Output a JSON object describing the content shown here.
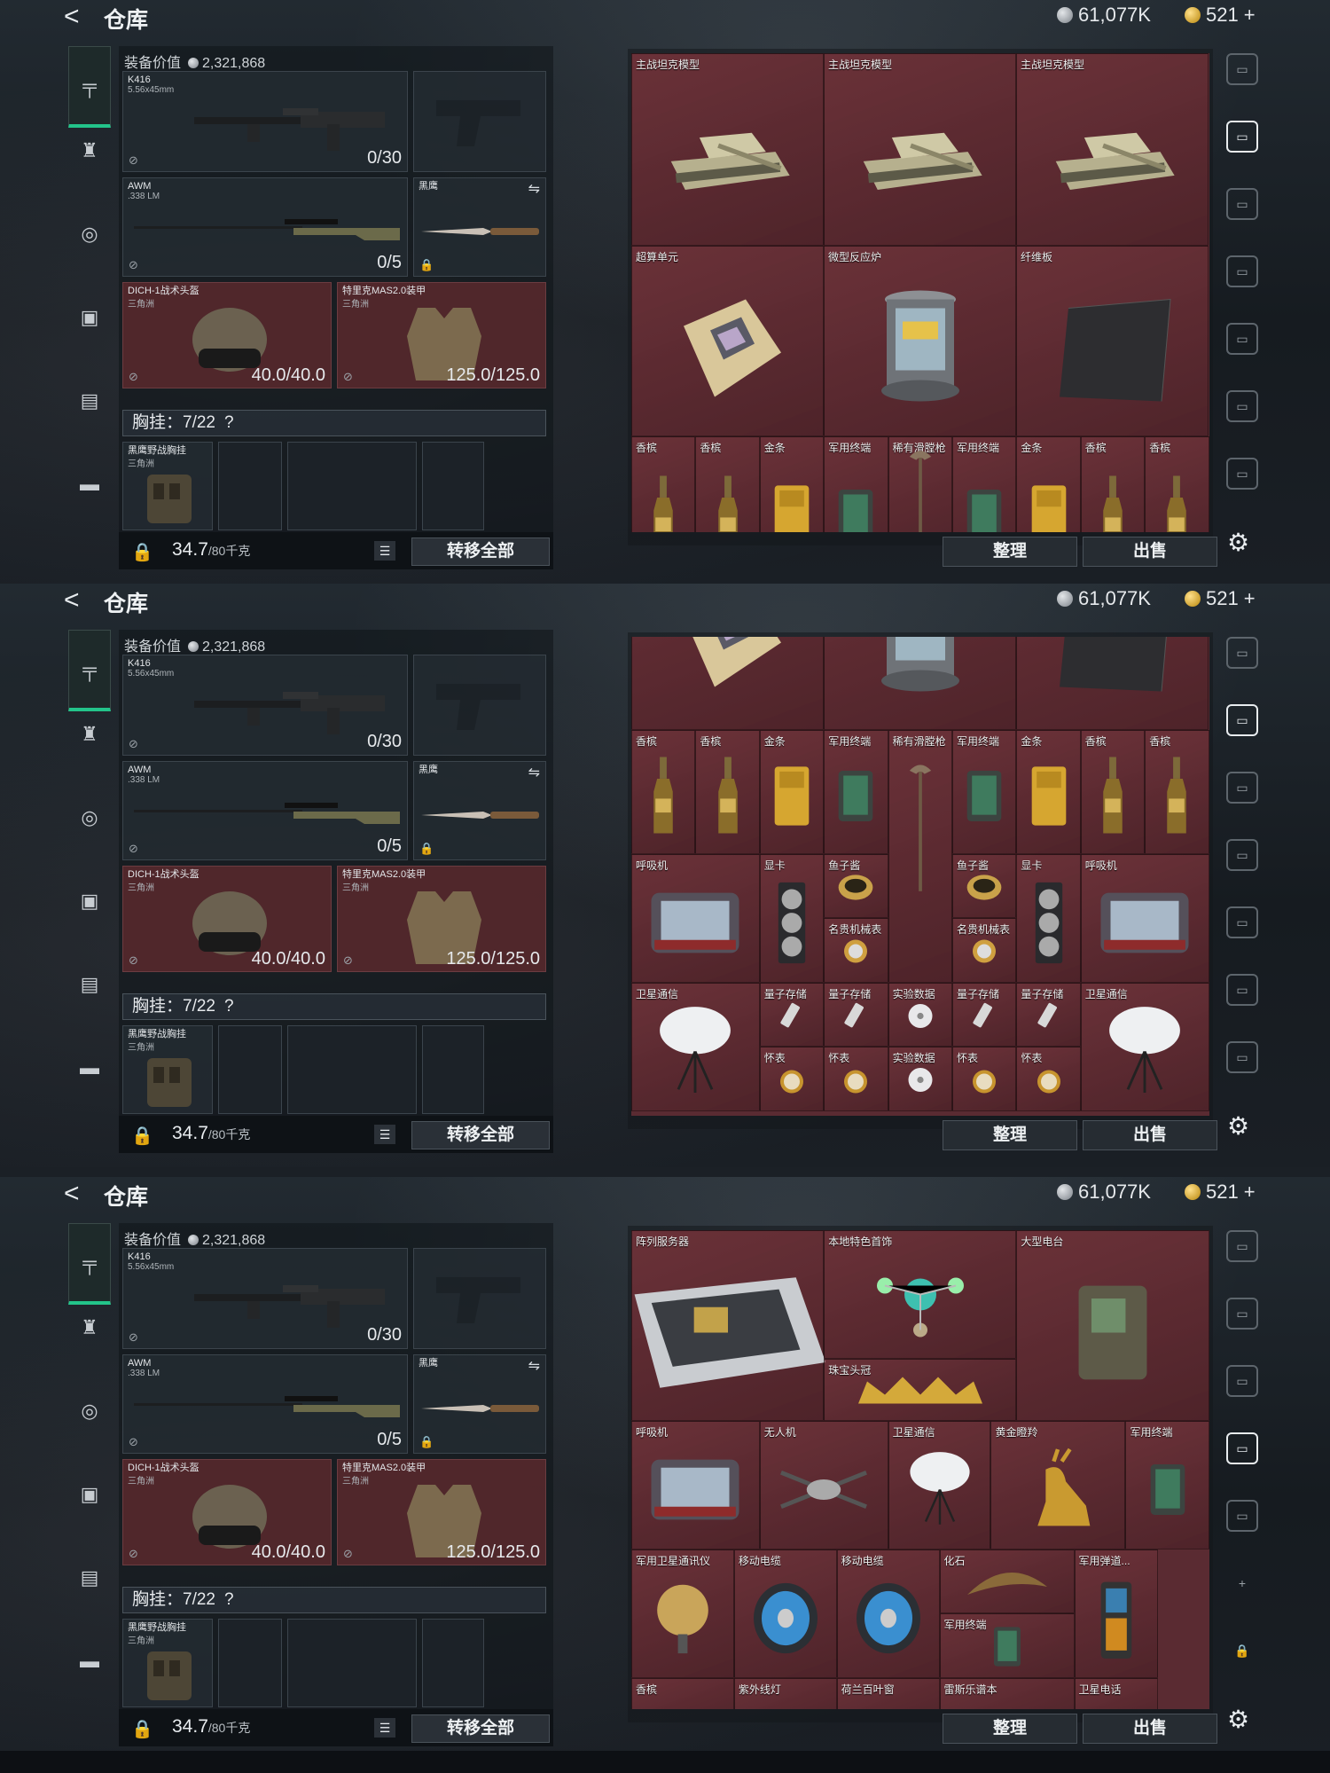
{
  "header": {
    "back_glyph": "<",
    "title": "仓库",
    "silver": "61,077K",
    "gold": "521",
    "gold_plus": "+"
  },
  "equipment": {
    "value_label": "装备价值",
    "value": "2,321,868",
    "primary": {
      "name": "K416",
      "caliber": "5.56x45mm",
      "ammo": "0/30"
    },
    "sniper": {
      "name": "AWM",
      "caliber": ".338 LM",
      "ammo": "0/5"
    },
    "melee": {
      "name": "黑鹰"
    },
    "helmet": {
      "name": "DICH-1战术头盔",
      "origin": "三角洲",
      "durability": "40.0/40.0"
    },
    "armor": {
      "name": "特里克MAS2.0装甲",
      "origin": "三角洲",
      "durability": "125.0/125.0"
    },
    "chest_label": "胸挂：7/22",
    "chest_help": "?",
    "chest_item": {
      "name": "黑鹰野战胸挂",
      "origin": "三角洲"
    },
    "weight": "34.7",
    "weight_cap": "/80千克",
    "transfer_all": "转移全部"
  },
  "storage": {
    "sort_label": "整理",
    "sell_label": "出售"
  },
  "screen1": {
    "items": [
      "主战坦克模型",
      "主战坦克模型",
      "主战坦克模型",
      "超算单元",
      "微型反应炉",
      "纤维板",
      "香槟",
      "香槟",
      "金条",
      "军用终端",
      "稀有滑膛枪",
      "军用终端",
      "金条",
      "香槟",
      "香槟"
    ]
  },
  "screen2": {
    "items": [
      "香槟",
      "香槟",
      "金条",
      "军用终端",
      "稀有滑膛枪",
      "军用终端",
      "金条",
      "香槟",
      "香槟",
      "呼吸机",
      "显卡",
      "鱼子酱",
      "鱼子酱",
      "显卡",
      "呼吸机",
      "名贵机械表",
      "名贵机械表",
      "卫星通信",
      "量子存储",
      "量子存储",
      "实验数据",
      "量子存储",
      "量子存储",
      "卫星通信",
      "怀表",
      "怀表",
      "实验数据",
      "怀表",
      "怀表"
    ]
  },
  "screen3": {
    "items": [
      "阵列服务器",
      "本地特色首饰",
      "大型电台",
      "珠宝头冠",
      "呼吸机",
      "无人机",
      "卫星通信",
      "黄金瞪羚",
      "军用终端",
      "军用卫星通讯仪",
      "移动电缆",
      "移动电缆",
      "化石",
      "军用终端",
      "军用弹道...",
      "香槟",
      "紫外线灯",
      "荷兰百叶窗",
      "雷斯乐谱本",
      "卫星电话"
    ]
  },
  "colors": {
    "accent_green": "#23c48a",
    "storage_red": "#5a2b32"
  }
}
